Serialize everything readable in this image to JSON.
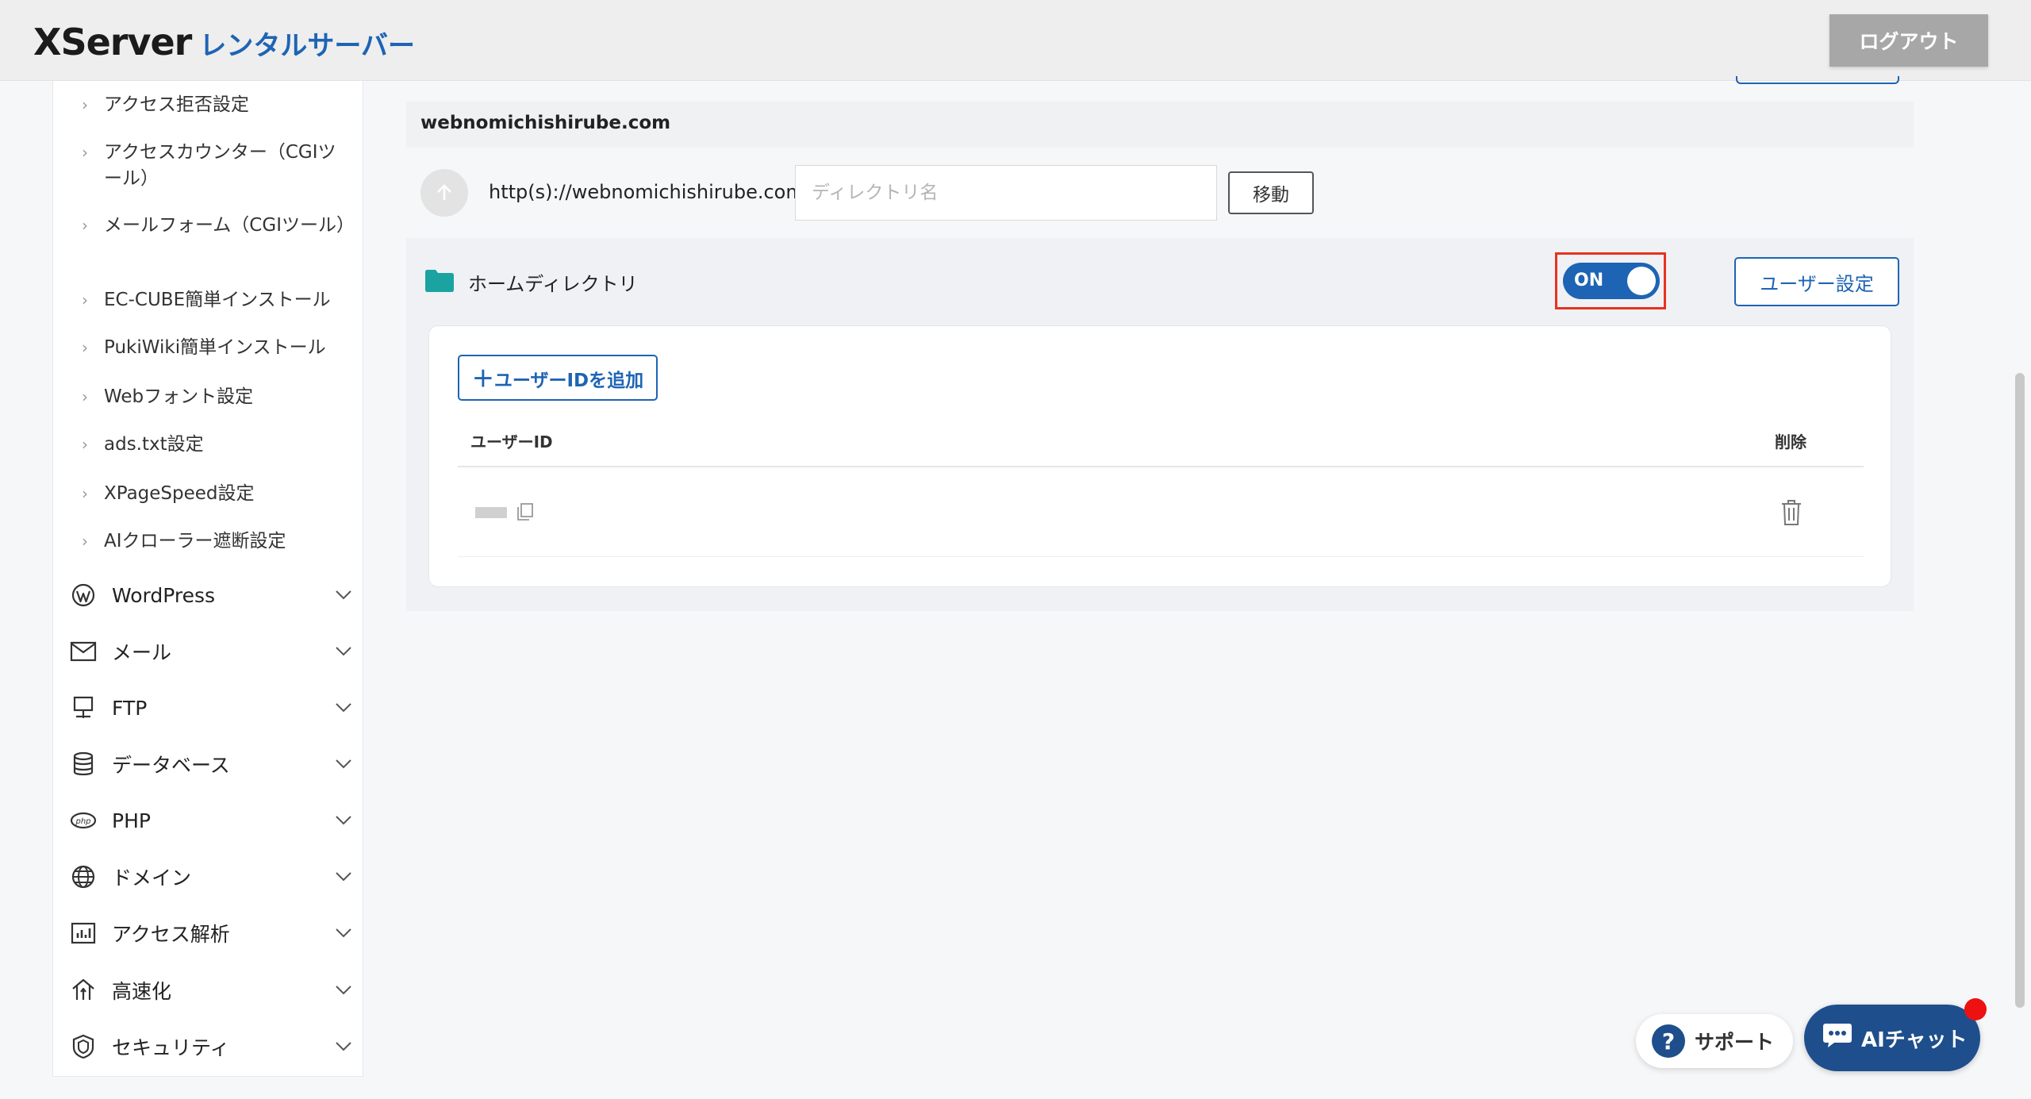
{
  "header": {
    "logo_main": "XServer",
    "logo_sub": "レンタルサーバー",
    "logout_label": "ログアウト"
  },
  "sidebar": {
    "sub_items": [
      {
        "label": "アクセス拒否設定"
      },
      {
        "label": "アクセスカウンター（CGIツール）"
      },
      {
        "label": "メールフォーム（CGIツール）"
      },
      {
        "label": "EC-CUBE簡単インストール"
      },
      {
        "label": "PukiWiki簡単インストール"
      },
      {
        "label": "Webフォント設定"
      },
      {
        "label": "ads.txt設定"
      },
      {
        "label": "XPageSpeed設定"
      },
      {
        "label": "AIクローラー遮断設定"
      }
    ],
    "main_items": [
      {
        "label": "WordPress",
        "icon": "wordpress-icon"
      },
      {
        "label": "メール",
        "icon": "mail-icon"
      },
      {
        "label": "FTP",
        "icon": "ftp-icon"
      },
      {
        "label": "データベース",
        "icon": "database-icon"
      },
      {
        "label": "PHP",
        "icon": "php-icon"
      },
      {
        "label": "ドメイン",
        "icon": "globe-icon"
      },
      {
        "label": "アクセス解析",
        "icon": "chart-icon"
      },
      {
        "label": "高速化",
        "icon": "speed-icon"
      },
      {
        "label": "セキュリティ",
        "icon": "shield-icon"
      }
    ]
  },
  "main": {
    "domain": "webnomichishirube.com",
    "url_prefix": "http(s)://webnomichishirube.com/",
    "dir_placeholder": "ディレクトリ名",
    "move_label": "移動",
    "home_dir_label": "ホームディレクトリ",
    "toggle_label": "ON",
    "toggle_state": "on",
    "user_setting_label": "ユーザー設定",
    "add_user_label": "ユーザーIDを追加",
    "table": {
      "col_user": "ユーザーID",
      "col_delete": "削除"
    }
  },
  "floating": {
    "support_label": "サポート",
    "ai_chat_label": "AIチャット"
  },
  "colors": {
    "accent": "#1e64b4",
    "highlight": "#e8311f",
    "folder": "#1aa3a0"
  }
}
